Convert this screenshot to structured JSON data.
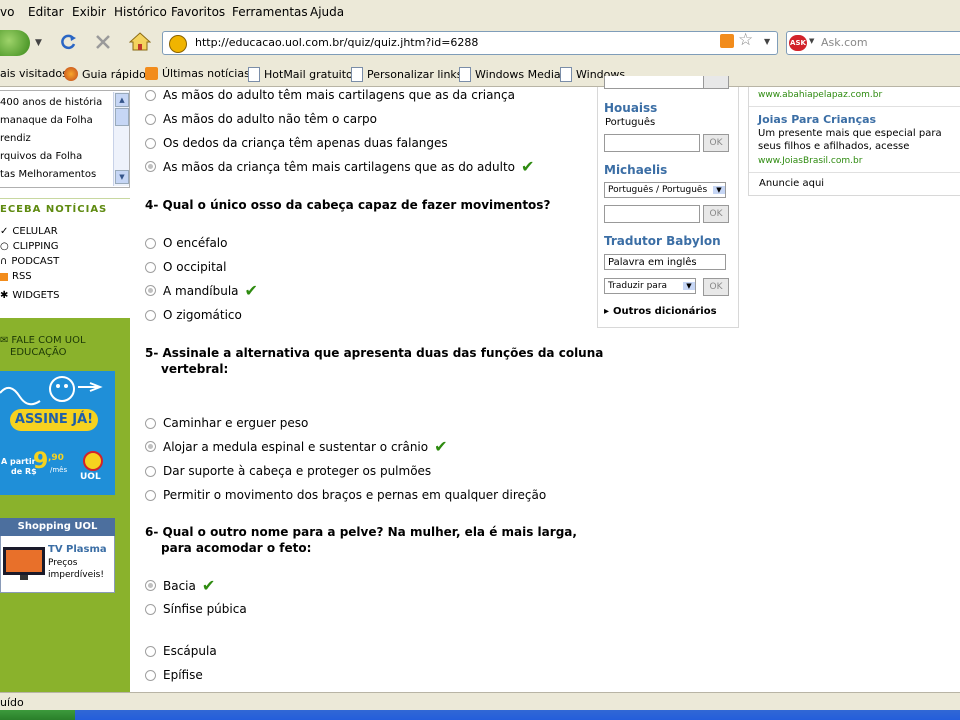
{
  "menu": {
    "items": [
      "vo",
      "Editar",
      "Exibir",
      "Histórico",
      "Favoritos",
      "Ferramentas",
      "Ajuda"
    ]
  },
  "nav": {
    "url": "http://educacao.uol.com.br/quiz/quiz.jhtm?id=6288",
    "search_placeholder": "Ask.com",
    "ask_badge": "ASK"
  },
  "bookmarks": {
    "items": [
      "ais visitados",
      "Guia rápido",
      "Últimas notícias",
      "HotMail gratuito",
      "Personalizar links",
      "Windows Media",
      "Windows"
    ]
  },
  "left": {
    "links": [
      "400 anos de história",
      "manaque da Folha",
      "rendiz",
      "rquivos da Folha",
      "tas Melhoramentos"
    ],
    "receba_title": "ECEBA NOTÍCIAS",
    "receba_items": [
      "CELULAR",
      "CLIPPING",
      "PODCAST",
      "RSS",
      "WIDGETS"
    ],
    "fale_line1": "FALE COM UOL",
    "fale_line2": "EDUCAÇÃO",
    "assine": "ASSINE JÁ!",
    "price_prefix_1": "A partir",
    "price_prefix_2": "de R$",
    "price_main": "9",
    "price_cents": ",90",
    "price_suffix": "/mês",
    "uol": "UOL",
    "shopping_title": "Shopping UOL",
    "tv_title": "TV Plasma",
    "tv_desc_1": "Preços",
    "tv_desc_2": "imperdíveis!"
  },
  "quiz": {
    "q3_options": [
      "As mãos do adulto têm mais cartilagens que as da criança",
      "As mãos do adulto não têm o carpo",
      "Os dedos da criança têm apenas duas falanges",
      "As mãos da criança têm mais cartilagens que as do adulto"
    ],
    "q4_title": "4- Qual o único osso da cabeça capaz de fazer movimentos?",
    "q4_options": [
      "O encéfalo",
      "O occipital",
      "A mandíbula",
      "O zigomático"
    ],
    "q5_title_1": "5- Assinale a alternativa que apresenta duas das funções da coluna",
    "q5_title_2": "vertebral:",
    "q5_options": [
      "Caminhar e erguer peso",
      "Alojar a medula espinal e sustentar o crânio",
      "Dar suporte à cabeça e proteger os pulmões",
      "Permitir o movimento dos braços e pernas em qualquer direção"
    ],
    "q6_title_1": "6- Qual o outro nome para a pelve? Na mulher, ela é mais larga,",
    "q6_title_2": "para acomodar o feto:",
    "q6_options": [
      "Bacia",
      "Sínfise púbica",
      "Escápula",
      "Epífise"
    ],
    "check": "✔"
  },
  "dict": {
    "houaiss": "Houaiss",
    "houaiss_lang": "Português",
    "ok": "OK",
    "michaelis": "Michaelis",
    "michaelis_select": "Português / Português",
    "babylon": "Tradutor Babylon",
    "babylon_input": "Palavra em inglês",
    "translate_select": "Traduzir para",
    "outros": "Outros dicionários"
  },
  "ads": {
    "url1": "www.abahiapelapaz.com.br",
    "title2": "Joias Para Crianças",
    "desc2_1": "Um presente mais que especial para",
    "desc2_2": "seus filhos e afilhados, acesse",
    "url2": "www.JoiasBrasil.com.br",
    "anuncie": "Anuncie aqui"
  },
  "status": {
    "text": "uído"
  },
  "colors": {
    "check": "#2e8b10",
    "accent_blue": "#3b6ea5",
    "uol_green": "#8ab22c"
  }
}
